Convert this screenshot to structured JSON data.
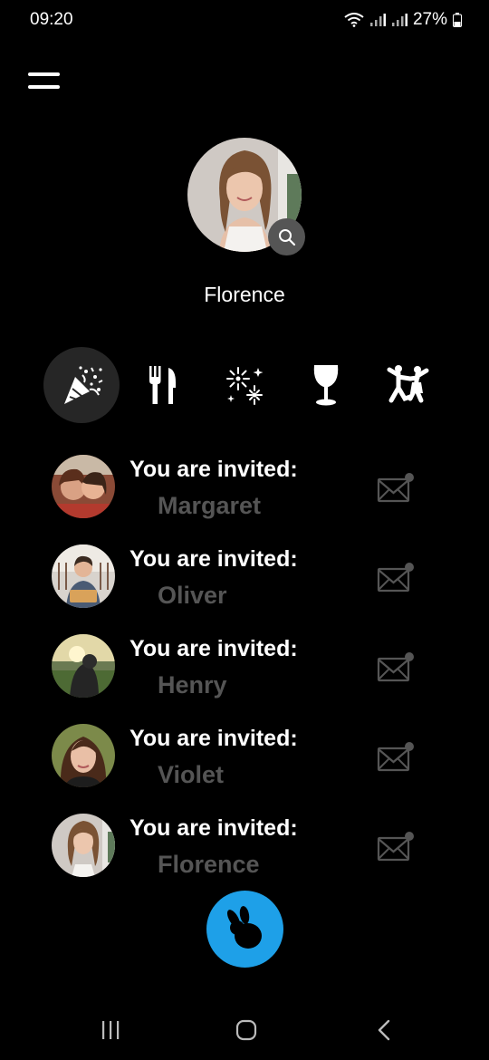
{
  "status_bar": {
    "time": "09:20",
    "battery": "27%"
  },
  "profile": {
    "name": "Florence"
  },
  "categories": [
    {
      "name": "party-popper-icon",
      "active": true
    },
    {
      "name": "fork-knife-icon",
      "active": false
    },
    {
      "name": "fireworks-icon",
      "active": false
    },
    {
      "name": "wine-glass-icon",
      "active": false
    },
    {
      "name": "dancing-couple-icon",
      "active": false
    }
  ],
  "invites": [
    {
      "title": "You are invited:",
      "name": "Margaret"
    },
    {
      "title": "You are invited:",
      "name": "Oliver"
    },
    {
      "title": "You are invited:",
      "name": "Henry"
    },
    {
      "title": "You are invited:",
      "name": "Violet"
    },
    {
      "title": "You are invited:",
      "name": "Florence"
    }
  ],
  "colors": {
    "accent": "#1ea0e8",
    "background": "#000000",
    "muted_text": "#555555",
    "active_category_bg": "#262626"
  }
}
